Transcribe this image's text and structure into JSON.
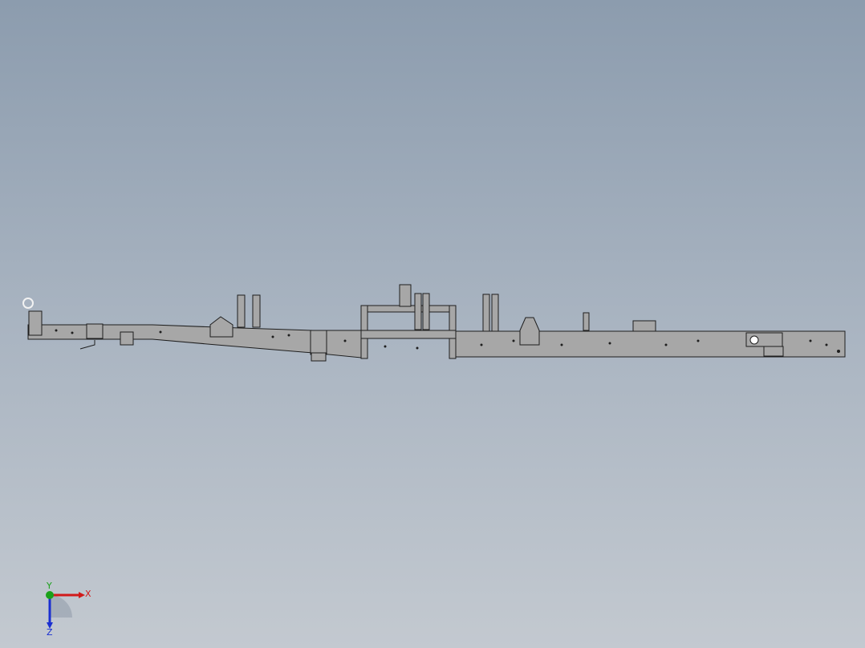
{
  "viewport": {
    "background_top": "#8c9cae",
    "background_bottom": "#c3c9d0"
  },
  "model": {
    "part": "frame-assembly",
    "fill_color": "#a7a7a7",
    "edge_color": "#1e1e1e"
  },
  "triad": {
    "x_label": "X",
    "y_label": "Y",
    "z_label": "Z",
    "x_color": "#d11a1a",
    "y_color": "#1aa11a",
    "z_color": "#1a2fd1"
  }
}
